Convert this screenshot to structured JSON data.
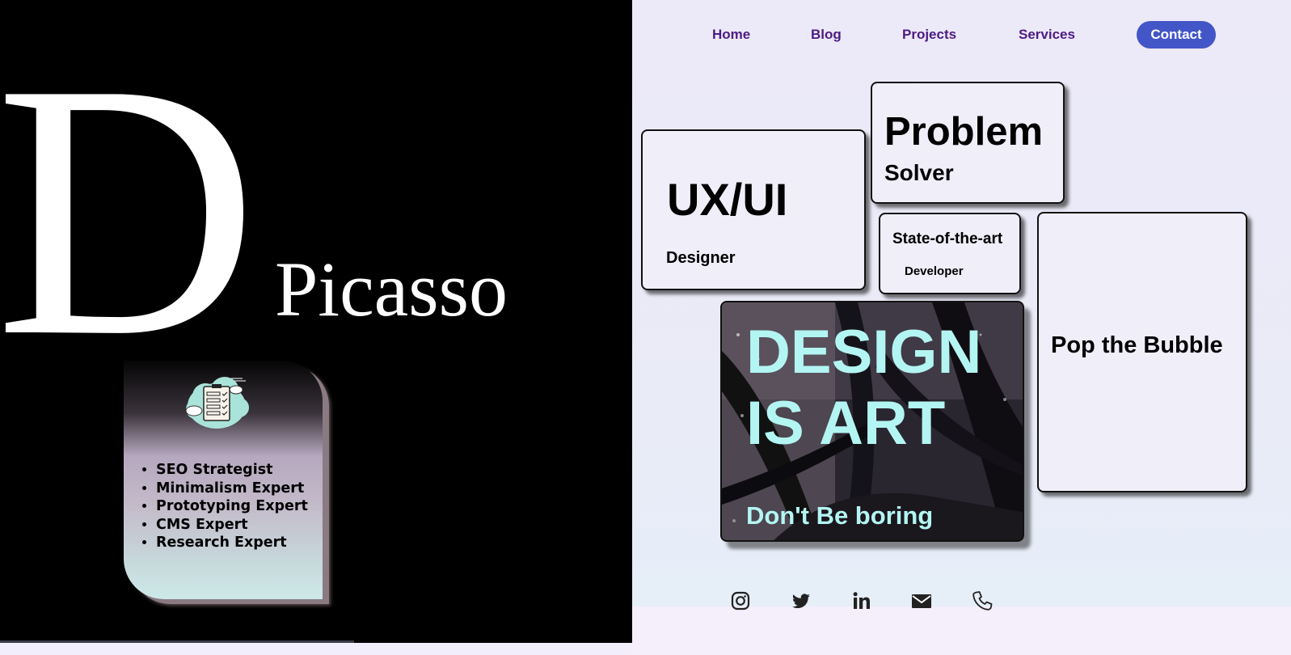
{
  "hero": {
    "letter": "D",
    "name": "Picasso"
  },
  "skills": {
    "icon": "cloud-checklist-icon",
    "items": [
      "SEO Strategist",
      "Minimalism Expert",
      "Prototyping Expert",
      "CMS Expert",
      "Research Expert"
    ]
  },
  "nav": {
    "items": [
      "Home",
      "Blog",
      "Projects",
      "Services"
    ],
    "contact": "Contact"
  },
  "cards": {
    "uxui_title": "UX/UI",
    "uxui_sub": "Designer",
    "problem_title": "Problem",
    "problem_sub": "Solver",
    "state_title": "State-of-the-art",
    "state_sub": "Developer",
    "bubble": "Pop the Bubble"
  },
  "art": {
    "title_line1": "DESIGN",
    "title_line2": "IS ART",
    "subtitle": "Don't Be boring"
  },
  "social": [
    "instagram-icon",
    "twitter-icon",
    "linkedin-icon",
    "email-icon",
    "phone-icon"
  ],
  "colors": {
    "nav_link": "#4d1b84",
    "contact_bg": "#4356c7",
    "art_text": "#b3f5f3"
  }
}
